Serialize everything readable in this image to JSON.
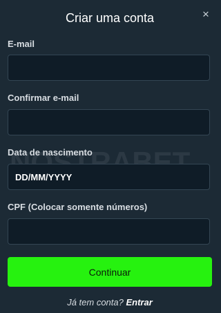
{
  "modal": {
    "title": "Criar uma conta",
    "close_icon": "×"
  },
  "form": {
    "email_label": "E-mail",
    "email_value": "",
    "confirm_email_label": "Confirmar e-mail",
    "confirm_email_value": "",
    "birthdate_label": "Data de nascimento",
    "birthdate_placeholder": "DD/MM/YYYY",
    "cpf_label": "CPF (Colocar somente números)",
    "cpf_value": ""
  },
  "watermark": "NOSTRABET",
  "actions": {
    "continue_label": "Continuar"
  },
  "footer": {
    "question": "Já tem conta?",
    "login_link": "Entrar"
  },
  "colors": {
    "background": "#1c2a35",
    "input_background": "#0f1c27",
    "accent_green": "#26f20f"
  }
}
